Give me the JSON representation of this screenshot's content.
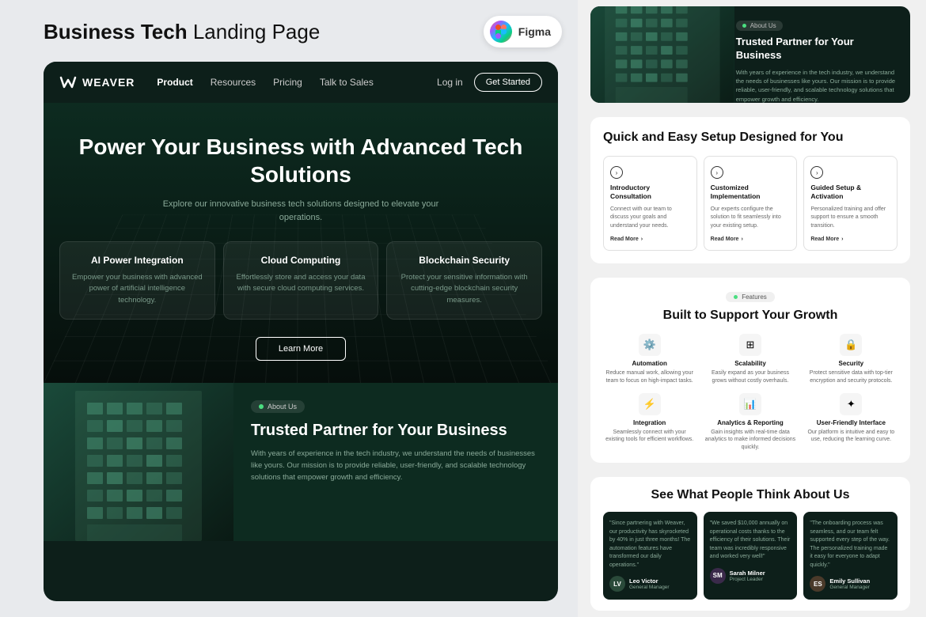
{
  "header": {
    "title_bold": "Business Tech",
    "title_light": " Landing Page",
    "figma_label": "Figma"
  },
  "nav": {
    "logo_text": "WEAVER",
    "links": [
      {
        "label": "Product",
        "active": true
      },
      {
        "label": "Resources",
        "active": false
      },
      {
        "label": "Pricing",
        "active": false
      },
      {
        "label": "Talk to Sales",
        "active": false
      }
    ],
    "login": "Log in",
    "cta": "Get Started"
  },
  "hero": {
    "title": "Power Your Business with Advanced Tech Solutions",
    "subtitle": "Explore our innovative business tech solutions designed to elevate your operations.",
    "cta_label": "Learn More",
    "features": [
      {
        "title": "AI Power Integration",
        "desc": "Empower your business with advanced power of artificial intelligence technology."
      },
      {
        "title": "Cloud Computing",
        "desc": "Effortlessly store and access your data with secure cloud computing services."
      },
      {
        "title": "Blockchain Security",
        "desc": "Protect your sensitive information with cutting-edge blockchain security measures."
      }
    ]
  },
  "about": {
    "badge": "About Us",
    "title": "Trusted Partner for Your Business",
    "desc": "With years of experience in the tech industry, we understand the needs of businesses like yours. Our mission is to provide reliable, user-friendly, and scalable technology solutions that empower growth and efficiency."
  },
  "setup": {
    "title": "Quick and Easy Setup Designed for You",
    "cards": [
      {
        "title": "Introductory Consultation",
        "desc": "Connect with our team to discuss your goals and understand your needs.",
        "read_more": "Read More"
      },
      {
        "title": "Customized Implementation",
        "desc": "Our experts configure the solution to fit seamlessly into your existing setup.",
        "read_more": "Read More"
      },
      {
        "title": "Guided Setup & Activation",
        "desc": "Personalized training and offer support to ensure a smooth transition.",
        "read_more": "Read More"
      }
    ]
  },
  "features": {
    "badge": "Features",
    "title": "Built to Support Your Growth",
    "items": [
      {
        "icon": "⚙",
        "title": "Automation",
        "desc": "Reduce manual work, allowing your team to focus on high-impact tasks."
      },
      {
        "icon": "⊞",
        "title": "Scalability",
        "desc": "Easily expand as your business grows without costly overhauls."
      },
      {
        "icon": "🔒",
        "title": "Security",
        "desc": "Protect sensitive data with top-tier encryption and security protocols."
      },
      {
        "icon": "⚡",
        "title": "Integration",
        "desc": "Seamlessly connect with your existing tools for efficient workflows."
      },
      {
        "icon": "📊",
        "title": "Analytics & Reporting",
        "desc": "Gain insights with real-time data analytics to make informed decisions quickly."
      },
      {
        "icon": "✦",
        "title": "User-Friendly Interface",
        "desc": "Our platform is intuitive and easy to use, reducing the learning curve."
      }
    ]
  },
  "testimonials": {
    "title": "See What People Think About Us",
    "items": [
      {
        "text": "\"Since partnering with Weaver, our productivity has skyrocketed by 40% in just three months! The automation features have transformed our daily operations.\"",
        "name": "Leo Victor",
        "role": "General Manager",
        "avatar_initials": "LV",
        "avatar_color": "#2a4a3a"
      },
      {
        "text": "\"We saved $10,000 annually on operational costs thanks to the efficiency of their solutions. Their team was incredibly responsive and worked very well!\"",
        "name": "Sarah Milner",
        "role": "Project Leader",
        "avatar_initials": "SM",
        "avatar_color": "#3a2a4a"
      },
      {
        "text": "\"The onboarding process was seamless, and our team felt supported every step of the way. The personalized training made it easy for everyone to adapt quickly.\"",
        "name": "Emily Sullivan",
        "role": "General Manager",
        "avatar_initials": "ES",
        "avatar_color": "#4a3a2a"
      }
    ]
  }
}
